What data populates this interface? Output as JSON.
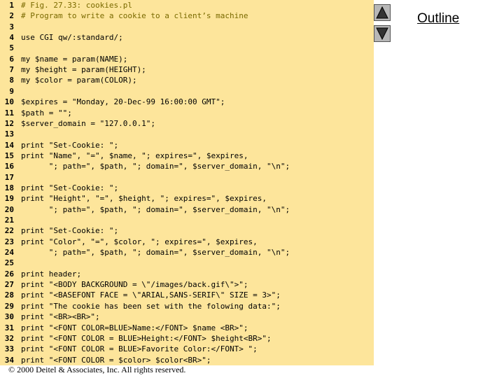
{
  "code_lines": [
    {
      "n": "1",
      "t": "# Fig. 27.33: cookies.pl",
      "cls": "comment"
    },
    {
      "n": "2",
      "t": "# Program to write a cookie to a client’s machine",
      "cls": "comment"
    },
    {
      "n": "3",
      "t": ""
    },
    {
      "n": "4",
      "t": "use CGI qw/:standard/;"
    },
    {
      "n": "5",
      "t": ""
    },
    {
      "n": "6",
      "t": "my $name = param(NAME);"
    },
    {
      "n": "7",
      "t": "my $height = param(HEIGHT);"
    },
    {
      "n": "8",
      "t": "my $color = param(COLOR);"
    },
    {
      "n": "9",
      "t": ""
    },
    {
      "n": "10",
      "t": "$expires = \"Monday, 20-Dec-99 16:00:00 GMT\";"
    },
    {
      "n": "11",
      "t": "$path = \"\";"
    },
    {
      "n": "12",
      "t": "$server_domain = \"127.0.0.1\";"
    },
    {
      "n": "13",
      "t": ""
    },
    {
      "n": "14",
      "t": "print \"Set-Cookie: \";"
    },
    {
      "n": "15",
      "t": "print \"Name\", \"=\", $name, \"; expires=\", $expires,"
    },
    {
      "n": "16",
      "t": "      \"; path=\", $path, \"; domain=\", $server_domain, \"\\n\";"
    },
    {
      "n": "17",
      "t": ""
    },
    {
      "n": "18",
      "t": "print \"Set-Cookie: \";"
    },
    {
      "n": "19",
      "t": "print \"Height\", \"=\", $height, \"; expires=\", $expires,"
    },
    {
      "n": "20",
      "t": "      \"; path=\", $path, \"; domain=\", $server_domain, \"\\n\";"
    },
    {
      "n": "21",
      "t": ""
    },
    {
      "n": "22",
      "t": "print \"Set-Cookie: \";"
    },
    {
      "n": "23",
      "t": "print \"Color\", \"=\", $color, \"; expires=\", $expires,"
    },
    {
      "n": "24",
      "t": "      \"; path=\", $path, \"; domain=\", $server_domain, \"\\n\";"
    },
    {
      "n": "25",
      "t": ""
    },
    {
      "n": "26",
      "t": "print header;"
    },
    {
      "n": "27",
      "t": "print \"<BODY BACKGROUND = \\\"/images/back.gif\\\">\";"
    },
    {
      "n": "28",
      "t": "print \"<BASEFONT FACE = \\\"ARIAL,SANS-SERIF\\\" SIZE = 3>\";"
    },
    {
      "n": "29",
      "t": "print \"The cookie has been set with the folowing data:\";"
    },
    {
      "n": "30",
      "t": "print \"<BR><BR>\";"
    },
    {
      "n": "31",
      "t": "print \"<FONT COLOR=BLUE>Name:</FONT> $name <BR>\";"
    },
    {
      "n": "32",
      "t": "print \"<FONT COLOR = BLUE>Height:</FONT> $height<BR>\";"
    },
    {
      "n": "33",
      "t": "print \"<FONT COLOR = BLUE>Favorite Color:</FONT> \";"
    },
    {
      "n": "34",
      "t": "print \"<FONT COLOR = $color> $color<BR>\";"
    }
  ],
  "footer": "© 2000 Deitel & Associates, Inc. All rights reserved.",
  "nav": {
    "up_icon": "triangle-up-icon",
    "down_icon": "triangle-down-icon",
    "outline_label": "Outline"
  },
  "colors": {
    "panel_bg": "#fde59b",
    "comment": "#7a6a00",
    "button": "#b7b7b7"
  }
}
